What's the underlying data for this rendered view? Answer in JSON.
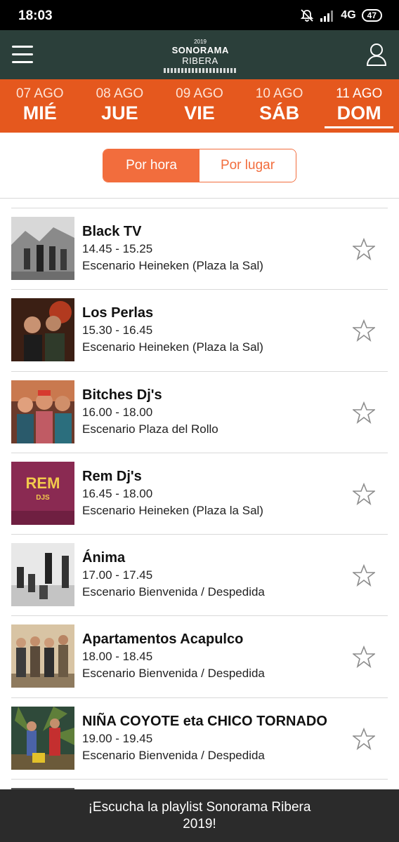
{
  "status": {
    "time": "18:03",
    "network": "4G",
    "battery": "47"
  },
  "header": {
    "logo_year": "2019",
    "logo_name": "SONORAMA",
    "logo_name2": "RIBERA"
  },
  "dates": [
    {
      "date": "07 AGO",
      "day": "MIÉ",
      "active": false
    },
    {
      "date": "08 AGO",
      "day": "JUE",
      "active": false
    },
    {
      "date": "09 AGO",
      "day": "VIE",
      "active": false
    },
    {
      "date": "10 AGO",
      "day": "SÁB",
      "active": false
    },
    {
      "date": "11 AGO",
      "day": "DOM",
      "active": true
    }
  ],
  "toggle": {
    "by_hour": "Por hora",
    "by_place": "Por lugar",
    "selected": "by_hour"
  },
  "events": [
    {
      "name": "Black TV",
      "time": "14.45 - 15.25",
      "venue": "Escenario Heineken (Plaza la Sal)"
    },
    {
      "name": "Los Perlas",
      "time": "15.30 - 16.45",
      "venue": "Escenario Heineken (Plaza la Sal)"
    },
    {
      "name": "Bitches Dj's",
      "time": "16.00 - 18.00",
      "venue": "Escenario Plaza del Rollo"
    },
    {
      "name": "Rem Dj's",
      "time": "16.45 - 18.00",
      "venue": "Escenario Heineken (Plaza la Sal)"
    },
    {
      "name": "Ánima",
      "time": "17.00 - 17.45",
      "venue": "Escenario Bienvenida / Despedida"
    },
    {
      "name": "Apartamentos Acapulco",
      "time": "18.00 - 18.45",
      "venue": "Escenario Bienvenida / Despedida"
    },
    {
      "name": "NIÑA COYOTE eta CHICO TORNADO",
      "time": "19.00 - 19.45",
      "venue": "Escenario Bienvenida / Despedida"
    }
  ],
  "thumbnail_texts": {
    "rem_main": "REM",
    "rem_sub": "DJS"
  },
  "banner": {
    "text": "¡Escucha la playlist Sonorama Ribera 2019!"
  },
  "colors": {
    "accent": "#e5581e",
    "toggle": "#f26d3d",
    "appbar": "#2b3f3a",
    "banner": "#2b2b2b"
  }
}
